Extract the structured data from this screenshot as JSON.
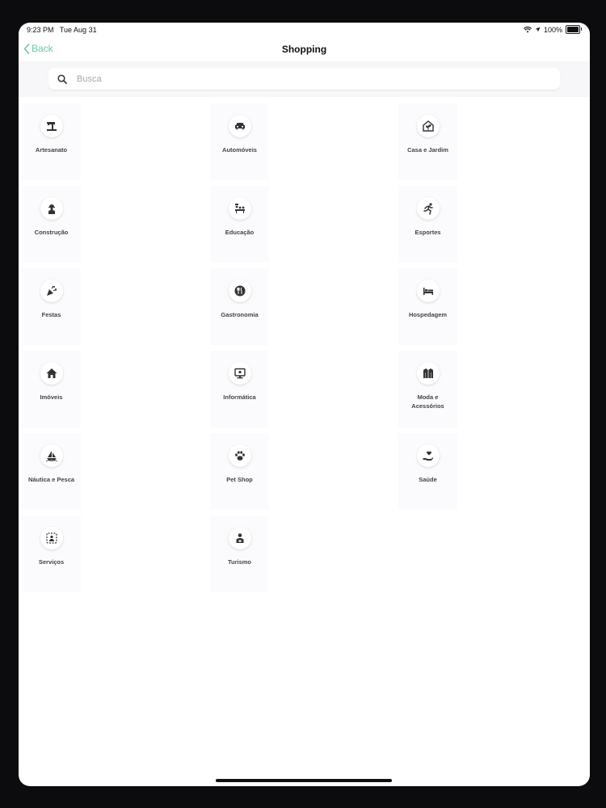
{
  "status_bar": {
    "time": "9:23 PM",
    "date": "Tue Aug 31",
    "battery": "100%"
  },
  "nav": {
    "back_label": "Back",
    "title": "Shopping"
  },
  "search": {
    "placeholder": "Busca"
  },
  "colors": {
    "accent": "#6ec5a6",
    "icon": "#333333",
    "tile_bg": "#fbfbfd"
  },
  "categories": [
    {
      "label": "Artesanato",
      "icon": "sewing-machine-icon"
    },
    {
      "label": "Automóveis",
      "icon": "car-icon"
    },
    {
      "label": "Casa e Jardim",
      "icon": "house-plant-icon"
    },
    {
      "label": "Construção",
      "icon": "construction-worker-icon"
    },
    {
      "label": "Educação",
      "icon": "students-icon"
    },
    {
      "label": "Esportes",
      "icon": "runner-icon"
    },
    {
      "label": "Festas",
      "icon": "party-popper-icon"
    },
    {
      "label": "Gastronomia",
      "icon": "cutlery-icon"
    },
    {
      "label": "Hospedagem",
      "icon": "bed-icon"
    },
    {
      "label": "Imóveis",
      "icon": "home-icon"
    },
    {
      "label": "Informática",
      "icon": "computer-icon"
    },
    {
      "label": "Moda e Acessórios",
      "icon": "jacket-icon"
    },
    {
      "label": "Náutica e Pesca",
      "icon": "sailboat-icon"
    },
    {
      "label": "Pet Shop",
      "icon": "paw-icon"
    },
    {
      "label": "Saúde",
      "icon": "heart-hand-icon"
    },
    {
      "label": "Serviços",
      "icon": "services-icon"
    },
    {
      "label": "Turismo",
      "icon": "traveler-icon"
    }
  ]
}
